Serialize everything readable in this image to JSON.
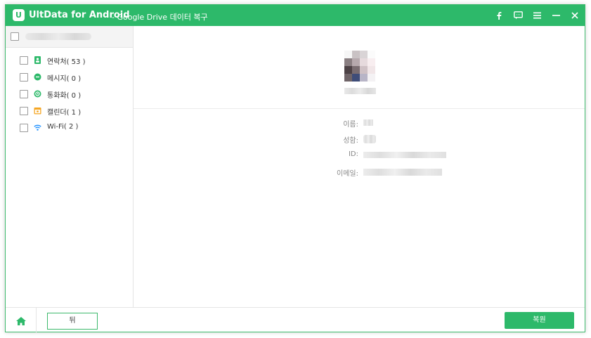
{
  "titlebar": {
    "app_name": "UltData for Android",
    "subtitle": "- Google Drive 데이터 복구",
    "logo_letter": "U",
    "icons": [
      "facebook-icon",
      "feedback-icon",
      "menu-icon",
      "minimize-icon",
      "close-icon"
    ]
  },
  "sidebar": {
    "account": {
      "checked": false
    },
    "categories": [
      {
        "label": "연락처( 53 )",
        "icon": "contacts-icon",
        "color": "#2db96a",
        "checked": false
      },
      {
        "label": "메시지( 0 )",
        "icon": "messages-icon",
        "color": "#2db96a",
        "checked": false
      },
      {
        "label": "통화화( 0 )",
        "icon": "call-log-icon",
        "color": "#2db96a",
        "checked": false
      },
      {
        "label": "캘린더( 1 )",
        "icon": "calendar-icon",
        "color": "#f5a623",
        "checked": false
      },
      {
        "label": "Wi-Fi( 2 )",
        "icon": "wifi-icon",
        "color": "#1e90ff",
        "checked": false
      }
    ]
  },
  "profile": {
    "fields": [
      {
        "label": "이름:"
      },
      {
        "label": "성함:"
      },
      {
        "label": "ID:"
      },
      {
        "label": "이메일:"
      }
    ]
  },
  "footer": {
    "back_label": "뒤",
    "restore_label": "복원"
  },
  "colors": {
    "accent": "#2db96a"
  }
}
